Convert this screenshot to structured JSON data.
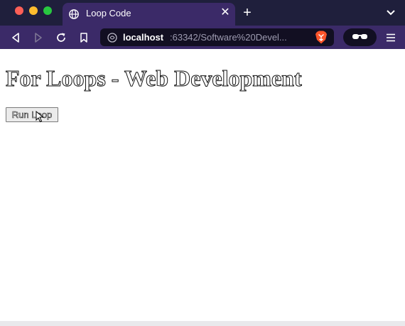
{
  "browser": {
    "tab": {
      "title": "Loop Code",
      "favicon": "globe-icon",
      "close_glyph": "✕"
    },
    "new_tab_glyph": "+",
    "url": {
      "host": "localhost",
      "rest": ":63342/Software%20Devel..."
    }
  },
  "page": {
    "heading": "For Loops - Web Development",
    "button_label": "Run Loop"
  },
  "colors": {
    "tabbar_bg": "#1f1f3c",
    "toolbar_bg": "#3b2a68",
    "urlbar_bg": "#120f22",
    "brave_orange": "#fb542b"
  }
}
